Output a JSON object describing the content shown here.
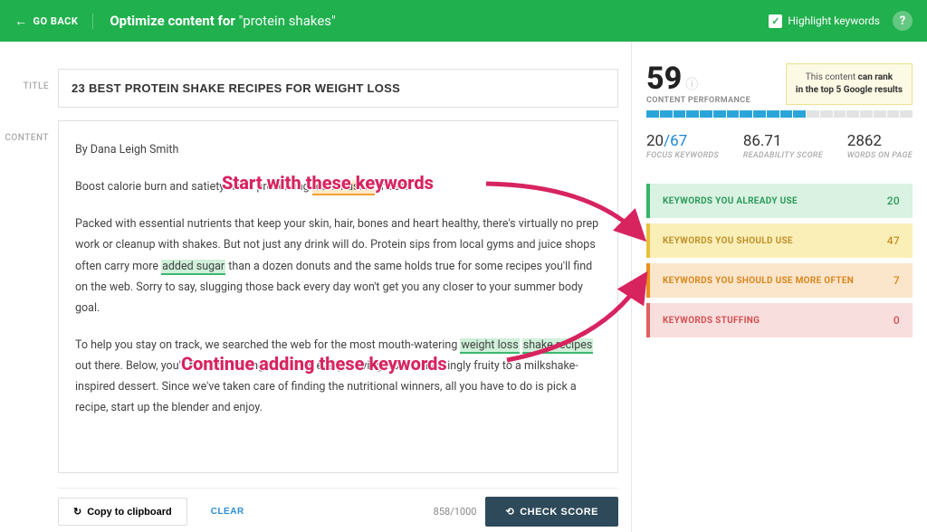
{
  "topbar": {
    "go_back": "GO BACK",
    "title_prefix": "Optimize content for",
    "keyword": "\"protein shakes\"",
    "highlight_label": "Highlight keywords"
  },
  "labels": {
    "title": "TITLE",
    "content": "CONTENT"
  },
  "title_value": "23 BEST PROTEIN SHAKE RECIPES FOR WEIGHT LOSS",
  "content": {
    "byline": "By Dana Leigh Smith",
    "p1_a": "Boost calorie burn and satiety while preserving ",
    "p1_hl": "lean muscle",
    "p1_b": " mass.",
    "p2_a": "Packed with essential nutrients that keep your skin, hair, bones and heart healthy, there's virtually no prep work or cleanup with shakes. But not just any drink will do. Protein sips from local gyms and juice shops often carry more ",
    "p2_hl": "added sugar",
    "p2_b": " than a dozen donuts and the same holds true for some recipes you'll find on the web. Sorry to say, slugging those back every day won't get you any closer to your summer body goal.",
    "p3_a": "To help you stay on track, we searched the web for the most mouth-watering ",
    "p3_hl1": "weight loss",
    "p3_mid": " ",
    "p3_hl2": "shake recipes",
    "p3_b": " out there. Below, you'll find something to satisfy every craving from refreshingly fruity to a milkshake-inspired dessert. Since we've taken care of finding the nutritional winners, all you have to do is pick a recipe, start up the blender and enjoy."
  },
  "actions": {
    "copy": "Copy to clipboard",
    "clear": "CLEAR",
    "counter": "858/1000",
    "check": "CHECK SCORE"
  },
  "score": {
    "value": "59",
    "label": "CONTENT PERFORMANCE",
    "rank_a": "This content ",
    "rank_b": "can rank",
    "rank_c": " in the top 5 Google results"
  },
  "metrics": {
    "focus_num": "20",
    "focus_denom": "/67",
    "focus_label": "FOCUS KEYWORDS",
    "read_val": "86.71",
    "read_label": "READABILITY SCORE",
    "words_val": "2862",
    "words_label": "WORDS ON PAGE"
  },
  "kw": {
    "already": {
      "label": "KEYWORDS YOU ALREADY USE",
      "count": "20"
    },
    "should": {
      "label": "KEYWORDS YOU SHOULD USE",
      "count": "47"
    },
    "more": {
      "label": "KEYWORDS YOU SHOULD USE MORE OFTEN",
      "count": "7"
    },
    "stuff": {
      "label": "KEYWORDS STUFFING",
      "count": "0"
    }
  },
  "annotations": {
    "a1": "Start with these keywords",
    "a2": "Continue adding these keywords"
  }
}
